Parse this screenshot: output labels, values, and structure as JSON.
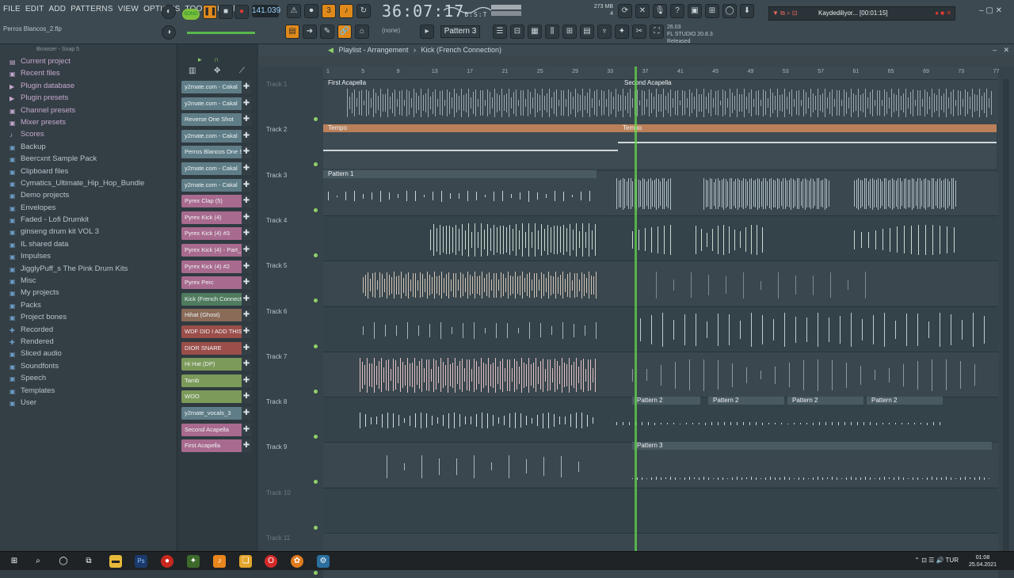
{
  "app": {
    "menu": [
      "FILE",
      "EDIT",
      "ADD",
      "PATTERNS",
      "VIEW",
      "OPTIONS",
      "TOOLS",
      "HELP"
    ],
    "file_name": "Perros Blancos_2.flp",
    "song_mode": "SONG",
    "tempo": "141.039",
    "time": "36:07:17",
    "time_suffix": "B:S:T",
    "memory": "273 MB",
    "memory_cpu": "4",
    "none_label": "(none)",
    "pattern_label": "Pattern 3",
    "fl_info_date": "26.03",
    "fl_info_name": "FL STUDIO 20.8.3",
    "fl_info_status": "Released",
    "recording_status": "Kaydediliyor... [00:01:15]"
  },
  "browser": {
    "title": "Browser - Snap 5",
    "items": [
      {
        "label": "Current project",
        "icon": "project-icon",
        "purple": true
      },
      {
        "label": "Recent files",
        "icon": "folder-icon",
        "purple": true
      },
      {
        "label": "Plugin database",
        "icon": "plug-icon",
        "purple": true
      },
      {
        "label": "Plugin presets",
        "icon": "plug-icon",
        "purple": true
      },
      {
        "label": "Channel presets",
        "icon": "folder-icon",
        "purple": true
      },
      {
        "label": "Mixer presets",
        "icon": "folder-icon",
        "purple": true
      },
      {
        "label": "Scores",
        "icon": "note-icon",
        "purple": true
      },
      {
        "label": "Backup",
        "icon": "folder-icon",
        "purple": false
      },
      {
        "label": "Beercxnt Sample Pack",
        "icon": "folder-icon",
        "purple": false
      },
      {
        "label": "Clipboard files",
        "icon": "folder-icon",
        "purple": false
      },
      {
        "label": "Cymatics_Ultimate_Hip_Hop_Bundle",
        "icon": "folder-icon",
        "purple": false
      },
      {
        "label": "Demo projects",
        "icon": "folder-icon",
        "purple": false
      },
      {
        "label": "Envelopes",
        "icon": "folder-icon",
        "purple": false
      },
      {
        "label": "Faded - Lofi Drumkit",
        "icon": "folder-icon",
        "purple": false
      },
      {
        "label": "ginseng drum kit VOL 3",
        "icon": "folder-icon",
        "purple": false
      },
      {
        "label": "IL shared data",
        "icon": "folder-icon",
        "purple": false
      },
      {
        "label": "Impulses",
        "icon": "folder-icon",
        "purple": false
      },
      {
        "label": "JigglyPuff_s The Pink Drum Kits",
        "icon": "folder-icon",
        "purple": false
      },
      {
        "label": "Misc",
        "icon": "folder-icon",
        "purple": false
      },
      {
        "label": "My projects",
        "icon": "folder-icon",
        "purple": false
      },
      {
        "label": "Packs",
        "icon": "folder-icon",
        "purple": false
      },
      {
        "label": "Project bones",
        "icon": "folder-icon",
        "purple": false
      },
      {
        "label": "Recorded",
        "icon": "plus-icon",
        "purple": false
      },
      {
        "label": "Rendered",
        "icon": "plus-icon",
        "purple": false
      },
      {
        "label": "Sliced audio",
        "icon": "folder-icon",
        "purple": false
      },
      {
        "label": "Soundfonts",
        "icon": "folder-icon",
        "purple": false
      },
      {
        "label": "Speech",
        "icon": "folder-icon",
        "purple": false
      },
      {
        "label": "Templates",
        "icon": "folder-icon",
        "purple": false
      },
      {
        "label": "User",
        "icon": "folder-icon",
        "purple": false
      }
    ]
  },
  "channels": [
    {
      "label": "y2mate.com - Cakal",
      "color": "#5f7d87"
    },
    {
      "label": "y2mate.com - Cakal",
      "color": "#5f7d87"
    },
    {
      "label": "Reverse One Shot",
      "color": "#5f7d87"
    },
    {
      "label": "y2mate.com - Cakal",
      "color": "#5f7d87"
    },
    {
      "label": "Perros Blancos One S",
      "color": "#5f7d87"
    },
    {
      "label": "y2mate.com - Cakal",
      "color": "#5f7d87"
    },
    {
      "label": "y2mate.com - Cakal",
      "color": "#5f7d87"
    },
    {
      "label": "Pyrex Clap (5)",
      "color": "#a86a8f"
    },
    {
      "label": "Pyrex Kick (4)",
      "color": "#a86a8f"
    },
    {
      "label": "Pyrex Kick (4) #3",
      "color": "#a86a8f"
    },
    {
      "label": "Pyrex Kick (4) - Part_2",
      "color": "#a86a8f"
    },
    {
      "label": "Pyrex Kick (4) #2",
      "color": "#a86a8f"
    },
    {
      "label": "Pyrex Perc",
      "color": "#a86a8f"
    },
    {
      "label": "Kick (French Connecti",
      "color": "#4f7b5e"
    },
    {
      "label": "Hihat (Ghost)",
      "color": "#8a6b58"
    },
    {
      "label": "WDF DID I ADD THIS",
      "color": "#9b4e4a"
    },
    {
      "label": "DIOR SNARE",
      "color": "#9b4e4a"
    },
    {
      "label": "Hi Hat (DP)",
      "color": "#7c9a5a"
    },
    {
      "label": "Tamb",
      "color": "#7c9a5a"
    },
    {
      "label": "WOO",
      "color": "#7c9a5a"
    },
    {
      "label": "y2mate_vocals_3",
      "color": "#5f7d87"
    },
    {
      "label": "Second Acapella",
      "color": "#a86a8f"
    },
    {
      "label": "First Acapella",
      "color": "#a86a8f"
    }
  ],
  "playlist": {
    "title": "Playlist - Arrangement",
    "breadcrumb": "Kick (French Connection)",
    "ruler": [
      "1",
      "5",
      "9",
      "13",
      "17",
      "21",
      "25",
      "29",
      "33",
      "37",
      "41",
      "45",
      "49",
      "53",
      "57",
      "61",
      "65",
      "69",
      "73",
      "77"
    ],
    "tracks": [
      {
        "label": "Track 1",
        "dim": true
      },
      {
        "label": "Track 2",
        "dim": false
      },
      {
        "label": "Track 3",
        "dim": false
      },
      {
        "label": "Track 4",
        "dim": false
      },
      {
        "label": "Track 5",
        "dim": false
      },
      {
        "label": "Track 6",
        "dim": false
      },
      {
        "label": "Track 7",
        "dim": false
      },
      {
        "label": "Track 8",
        "dim": false
      },
      {
        "label": "Track 9",
        "dim": false
      },
      {
        "label": "Track 10",
        "dim": true
      },
      {
        "label": "Track 11",
        "dim": true
      }
    ],
    "clips": {
      "first_acapella": "First Acapella",
      "second_acapella": "Second Acapella",
      "tempo": "Tempo",
      "pattern1": "Pattern 1",
      "pattern2": "Pattern 2",
      "pattern3": "Pattern 3"
    }
  },
  "taskbar": {
    "lang": "TUR",
    "time": "01:08",
    "date": "25.04.2021"
  }
}
